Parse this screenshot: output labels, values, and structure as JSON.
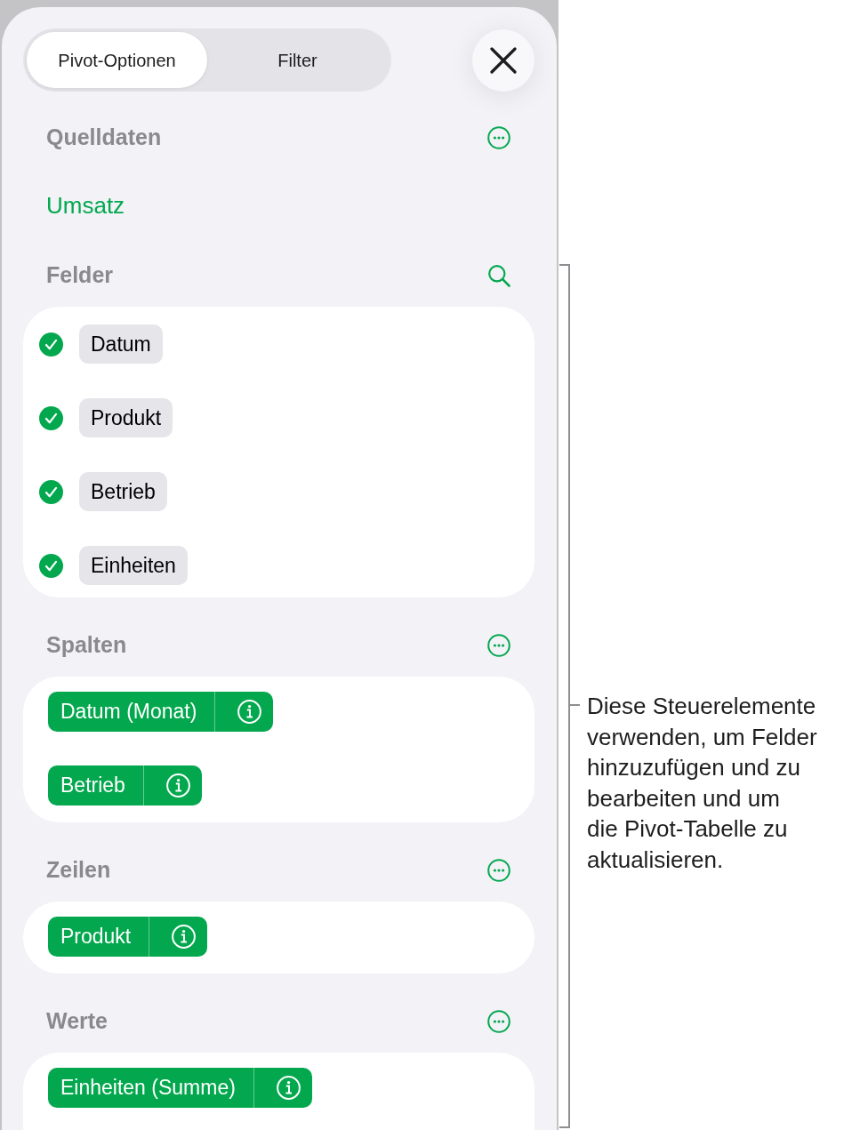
{
  "tabs": [
    {
      "label": "Pivot-Optionen",
      "selected": true
    },
    {
      "label": "Filter",
      "selected": false
    }
  ],
  "sections": [
    {
      "kind": "source",
      "title": "Quelldaten",
      "action": {
        "kind": "more"
      },
      "source": "Umsatz"
    },
    {
      "kind": "checklist",
      "title": "Felder",
      "action": {
        "kind": "search"
      },
      "fields": [
        {
          "label": "Datum",
          "checked": true
        },
        {
          "label": "Produkt",
          "checked": true
        },
        {
          "label": "Betrieb",
          "checked": true
        },
        {
          "label": "Einheiten",
          "checked": true
        }
      ]
    },
    {
      "kind": "chips",
      "title": "Spalten",
      "action": {
        "kind": "more"
      },
      "chips": [
        "Datum (Monat)",
        "Betrieb"
      ]
    },
    {
      "kind": "chips",
      "title": "Zeilen",
      "action": {
        "kind": "more"
      },
      "chips": [
        "Produkt"
      ]
    },
    {
      "kind": "chips",
      "title": "Werte",
      "action": {
        "kind": "more"
      },
      "chips": [
        "Einheiten (Summe)"
      ]
    }
  ],
  "callout": "Diese Steuerelemente\nverwenden, um Felder\nhinzuzufügen und zu\nbearbeiten und um\ndie Pivot-Tabelle zu\naktualisieren."
}
